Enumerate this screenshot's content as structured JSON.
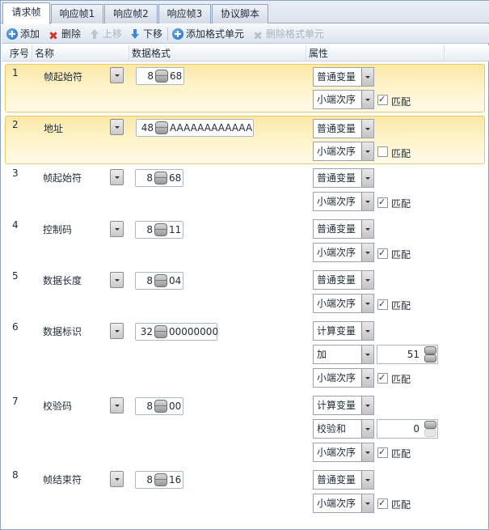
{
  "tabs": [
    "请求帧",
    "响应帧1",
    "响应帧2",
    "响应帧3",
    "协议脚本"
  ],
  "toolbar": {
    "add": "添加",
    "delete": "删除",
    "up": "上移",
    "down": "下移",
    "add_format": "添加格式单元",
    "delete_format": "删除格式单元"
  },
  "columns": {
    "no": "序号",
    "name": "名称",
    "format": "数据格式",
    "attr": "属性"
  },
  "rows": [
    {
      "no": "1",
      "name": "帧起始符",
      "len": "8",
      "value": "68",
      "type": "普通变量",
      "order": "小端次序",
      "match_label": "匹配",
      "match": true
    },
    {
      "no": "2",
      "name": "地址",
      "len": "48",
      "value": "AAAAAAAAAAAA",
      "type": "普通变量",
      "order": "小端次序",
      "match_label": "匹配",
      "match": false
    },
    {
      "no": "3",
      "name": "帧起始符",
      "len": "8",
      "value": "68",
      "type": "普通变量",
      "order": "小端次序",
      "match_label": "匹配",
      "match": true
    },
    {
      "no": "4",
      "name": "控制码",
      "len": "8",
      "value": "11",
      "type": "普通变量",
      "order": "小端次序",
      "match_label": "匹配",
      "match": true
    },
    {
      "no": "5",
      "name": "数据长度",
      "len": "8",
      "value": "04",
      "type": "普通变量",
      "order": "小端次序",
      "match_label": "匹配",
      "match": true
    },
    {
      "no": "6",
      "name": "数据标识",
      "len": "32",
      "value": "00000000",
      "type": "计算变量",
      "op": "加",
      "op_value": "51",
      "order": "小端次序",
      "match_label": "匹配",
      "match": true
    },
    {
      "no": "7",
      "name": "校验码",
      "len": "8",
      "value": "00",
      "type": "计算变量",
      "op": "校验和",
      "op_value": "0",
      "order": "小端次序",
      "match_label": "匹配",
      "match": true
    },
    {
      "no": "8",
      "name": "帧结束符",
      "len": "8",
      "value": "16",
      "type": "普通变量",
      "order": "小端次序",
      "match_label": "匹配",
      "match": true
    }
  ]
}
